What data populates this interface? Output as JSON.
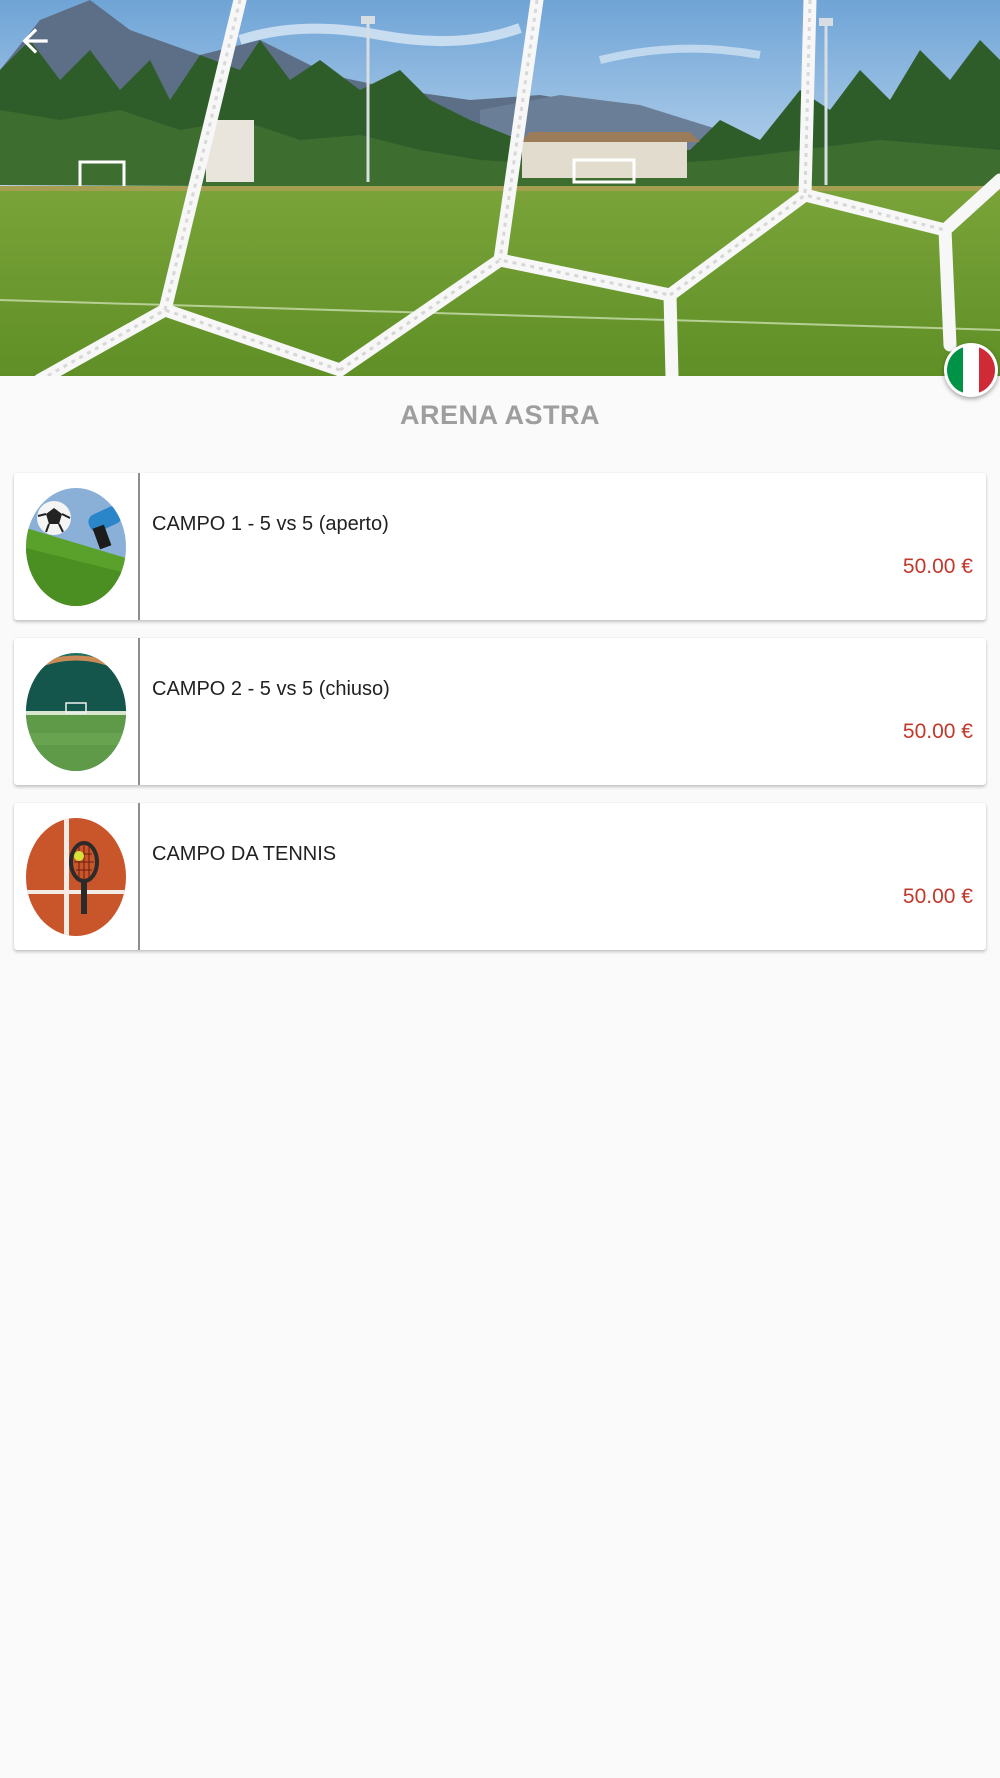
{
  "header": {
    "back_icon": "arrow-left-icon",
    "language_flag": "italy-flag-icon",
    "hero_image": "football-goal-net-field-photo"
  },
  "venue": {
    "title": "ARENA ASTRA"
  },
  "fields": [
    {
      "name": "CAMPO 1 - 5 vs 5 (aperto)",
      "price": "50.00 €",
      "thumbnail": "soccer-ball-grass-photo"
    },
    {
      "name": "CAMPO 2 - 5 vs 5 (chiuso)",
      "price": "50.00 €",
      "thumbnail": "indoor-pitch-photo"
    },
    {
      "name": "CAMPO DA TENNIS",
      "price": "50.00 €",
      "thumbnail": "tennis-racket-clay-photo"
    }
  ],
  "colors": {
    "price": "#c0392b",
    "title": "#9e9e9e",
    "flag_green": "#009246",
    "flag_white": "#ffffff",
    "flag_red": "#ce2b37"
  }
}
